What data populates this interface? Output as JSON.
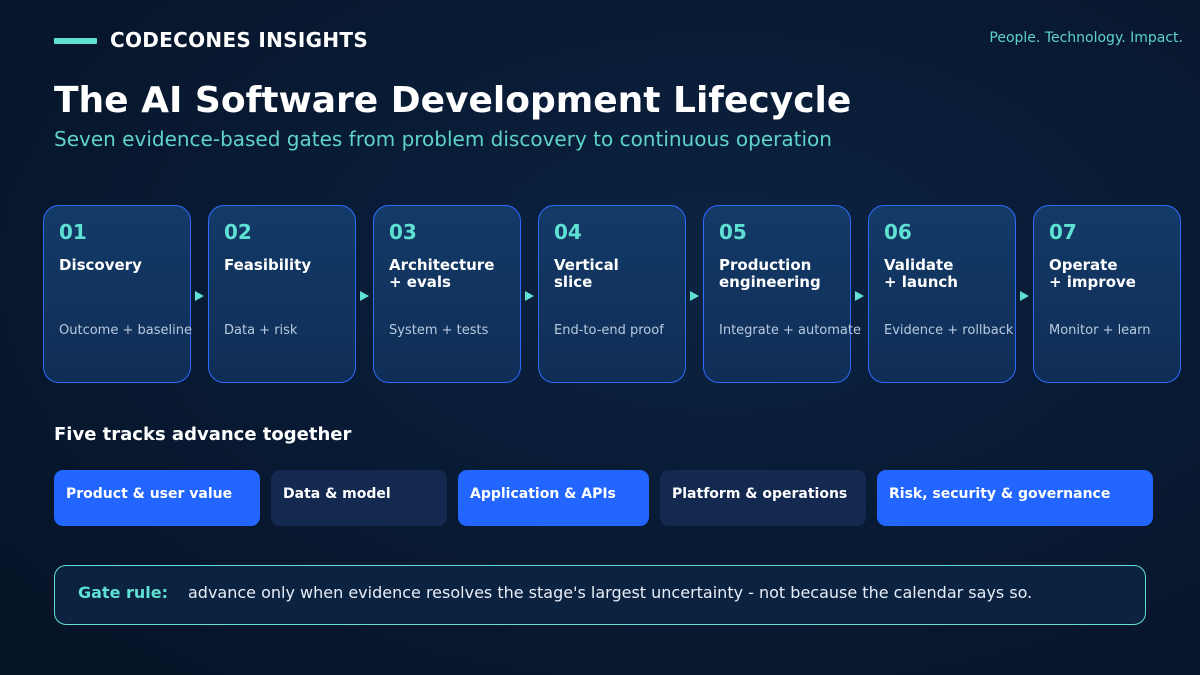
{
  "header": {
    "brand": "CODECONES INSIGHTS",
    "tagline": "People. Technology. Impact."
  },
  "title": "The AI Software Development Lifecycle",
  "subtitle": "Seven evidence-based gates from problem discovery to continuous operation",
  "stages": [
    {
      "number": "01",
      "name": "Discovery",
      "description": "Outcome + baseline"
    },
    {
      "number": "02",
      "name": "Feasibility",
      "description": "Data + risk"
    },
    {
      "number": "03",
      "name": "Architecture\n+ evals",
      "description": "System + tests"
    },
    {
      "number": "04",
      "name": "Vertical\nslice",
      "description": "End-to-end proof"
    },
    {
      "number": "05",
      "name": "Production\nengineering",
      "description": "Integrate + automate"
    },
    {
      "number": "06",
      "name": "Validate\n+ launch",
      "description": "Evidence + rollback"
    },
    {
      "number": "07",
      "name": "Operate\n+ improve",
      "description": "Monitor + learn"
    }
  ],
  "tracks_section": {
    "title": "Five tracks advance together",
    "tracks": [
      {
        "label": "Product & user value",
        "style": "accent"
      },
      {
        "label": "Data & model",
        "style": "muted"
      },
      {
        "label": "Application & APIs",
        "style": "accent"
      },
      {
        "label": "Platform & operations",
        "style": "muted"
      },
      {
        "label": "Risk, security & governance",
        "style": "accent"
      }
    ]
  },
  "gate_rule": {
    "label": "Gate rule:",
    "text": "advance only when evidence resolves the stage's largest uncertainty - not because the calendar says so."
  },
  "colors": {
    "background": "#081a33",
    "teal_accent": "#5ee0d2",
    "blue_accent": "#2266ff",
    "card_border": "#2f6bff",
    "muted_track": "#13294f"
  }
}
